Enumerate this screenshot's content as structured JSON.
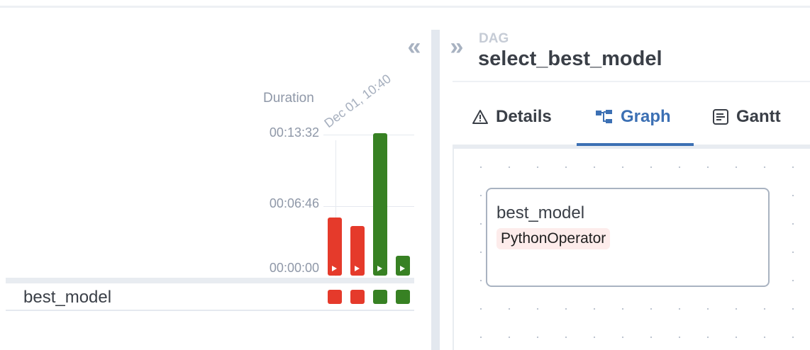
{
  "grid": {
    "duration_title": "Duration",
    "run_date": "Dec 01, 10:40",
    "ticks": [
      "00:13:32",
      "00:06:46",
      "00:00:00"
    ],
    "runs": [
      {
        "state": "failed",
        "duration_fraction": 0.41
      },
      {
        "state": "failed",
        "duration_fraction": 0.35
      },
      {
        "state": "success",
        "duration_fraction": 1.0
      },
      {
        "state": "success",
        "duration_fraction": 0.14
      }
    ],
    "task": {
      "label": "best_model",
      "instance_states": [
        "failed",
        "failed",
        "success",
        "success"
      ]
    },
    "colors": {
      "failed": "#e53a2b",
      "success": "#378123"
    }
  },
  "details": {
    "dag_tag": "DAG",
    "dag_title": "select_best_model",
    "tabs": [
      {
        "label": "Details",
        "icon": "warning-triangle-icon",
        "active": false
      },
      {
        "label": "Graph",
        "icon": "graph-icon",
        "active": true
      },
      {
        "label": "Gantt",
        "icon": "gantt-icon",
        "active": false
      }
    ],
    "node": {
      "name": "best_model",
      "operator": "PythonOperator"
    },
    "accent_color": "#3c70b4"
  }
}
